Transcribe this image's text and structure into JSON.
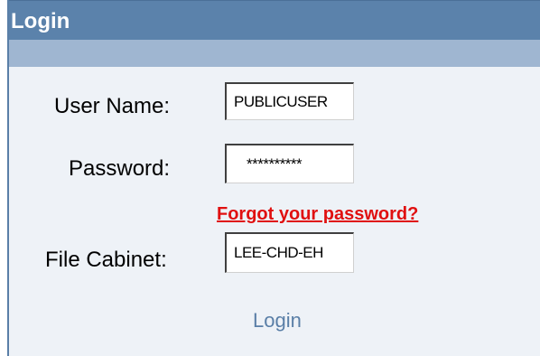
{
  "header": {
    "title": "Login"
  },
  "form": {
    "username_label": "User Name:",
    "username_value": "PUBLICUSER",
    "password_label": "Password:",
    "password_value": "**********",
    "forgot_link": "Forgot your password?",
    "cabinet_label": "File Cabinet:",
    "cabinet_value": "LEE-CHD-EH",
    "login_link": "Login"
  },
  "colors": {
    "header_bg": "#5b82ab",
    "subheader_bg": "#9fb6d1",
    "link_red": "#e01010",
    "login_blue": "#5a7fa7"
  }
}
